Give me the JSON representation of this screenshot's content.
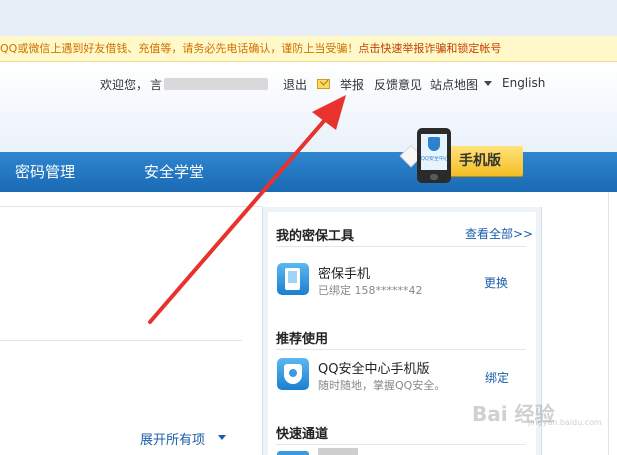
{
  "notice": {
    "warning_text": "QQ或微信上遇到好友借钱、充值等，请务必先电话确认，谨防上当受骗！",
    "link_text": "点击快速举报诈骗和锁定帐号"
  },
  "user_nav": {
    "welcome": "欢迎您，",
    "name_initial": "言",
    "logout": "退出",
    "report": "举报",
    "feedback": "反馈意见",
    "sitemap": "站点地图",
    "language": "English"
  },
  "nav": {
    "items": [
      {
        "label": "密码管理"
      },
      {
        "label": "安全学堂"
      }
    ]
  },
  "mobile_badge": {
    "label": "手机版",
    "phone_text": "QQ安全中心"
  },
  "main": {
    "expand_all": "展开所有项"
  },
  "sidebar": {
    "tools_title": "我的密保工具",
    "view_all": "查看全部>>",
    "tool": {
      "title": "密保手机",
      "status": "已绑定 158******42",
      "action": "更换"
    },
    "recommend_title": "推荐使用",
    "recommend": {
      "title": "QQ安全中心手机版",
      "desc": "随时随地，掌握QQ安全。",
      "action": "绑定"
    },
    "quick_title": "快速通道"
  },
  "watermark": {
    "text": "Bai 经验",
    "sub": "jingyan.baidu.com"
  },
  "colors": {
    "nav_blue": "#1f74bf",
    "link_blue": "#1a5faa",
    "notice_bg": "#fff8c8",
    "arrow_red": "#e8322e",
    "badge_yellow": "#f4be25"
  }
}
